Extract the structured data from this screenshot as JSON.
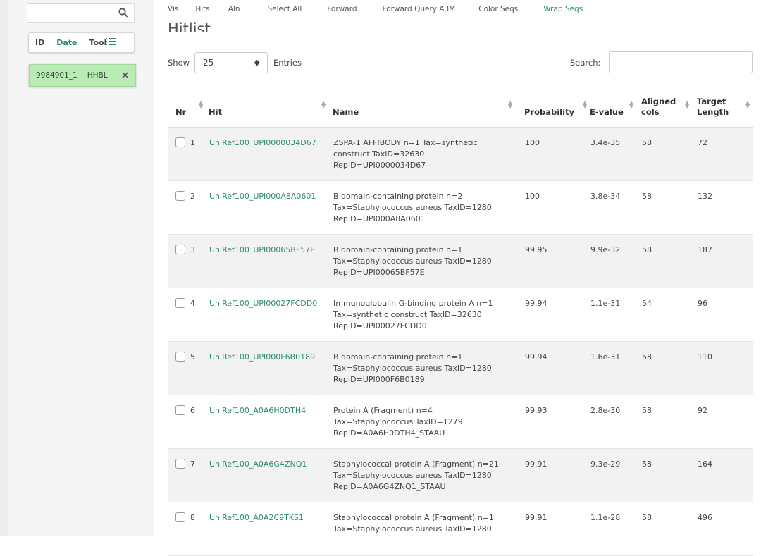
{
  "sidebar": {
    "search_icon": "search-icon",
    "sort": {
      "id": "ID",
      "date": "Date",
      "tool": "Tool"
    },
    "job": {
      "id": "9984901_1",
      "tool": "HHBL"
    }
  },
  "toolbar": {
    "vis": "Vis",
    "hits": "Hits",
    "aln": "Aln",
    "select_all": "Select All",
    "forward": "Forward",
    "forward_query": "Forward Query A3M",
    "color_seqs": "Color Seqs",
    "wrap_seqs": "Wrap Seqs"
  },
  "page_title": "Hitlist",
  "controls": {
    "show": "Show",
    "entries_value": "25",
    "entries": "Entries",
    "search": "Search:"
  },
  "table": {
    "headers": {
      "nr": "Nr",
      "hit": "Hit",
      "name": "Name",
      "probability": "Probability",
      "evalue": "E-value",
      "aligned_1": "Aligned",
      "aligned_2": "cols",
      "target_1": "Target",
      "target_2": "Length"
    },
    "rows": [
      {
        "nr": "1",
        "hit": "UniRef100_UPI0000034D67",
        "name": [
          "ZSPA-1 AFFIBODY n=1 Tax=synthetic",
          "construct TaxID=32630",
          "RepID=UPI0000034D67"
        ],
        "prob": "100",
        "evalue": "3.4e-35",
        "aligned": "58",
        "length": "72"
      },
      {
        "nr": "2",
        "hit": "UniRef100_UPI000A8A0601",
        "name": [
          "B domain-containing protein n=2",
          "Tax=Staphylococcus aureus TaxID=1280",
          "RepID=UPI000A8A0601"
        ],
        "prob": "100",
        "evalue": "3.8e-34",
        "aligned": "58",
        "length": "132"
      },
      {
        "nr": "3",
        "hit": "UniRef100_UPI00065BF57E",
        "name": [
          "B domain-containing protein n=1",
          "Tax=Staphylococcus aureus TaxID=1280",
          "RepID=UPI00065BF57E"
        ],
        "prob": "99.95",
        "evalue": "9.9e-32",
        "aligned": "58",
        "length": "187"
      },
      {
        "nr": "4",
        "hit": "UniRef100_UPI00027FCDD0",
        "name": [
          "Immunoglobulin G-binding protein A n=1",
          "Tax=synthetic construct TaxID=32630",
          "RepID=UPI00027FCDD0"
        ],
        "prob": "99.94",
        "evalue": "1.1e-31",
        "aligned": "54",
        "length": "96"
      },
      {
        "nr": "5",
        "hit": "UniRef100_UPI000F6B0189",
        "name": [
          "B domain-containing protein n=1",
          "Tax=Staphylococcus aureus TaxID=1280",
          "RepID=UPI000F6B0189"
        ],
        "prob": "99.94",
        "evalue": "1.6e-31",
        "aligned": "58",
        "length": "110"
      },
      {
        "nr": "6",
        "hit": "UniRef100_A0A6H0DTH4",
        "name": [
          "Protein A (Fragment) n=4",
          "Tax=Staphylococcus TaxID=1279",
          "RepID=A0A6H0DTH4_STAAU"
        ],
        "prob": "99.93",
        "evalue": "2.8e-30",
        "aligned": "58",
        "length": "92"
      },
      {
        "nr": "7",
        "hit": "UniRef100_A0A6G4ZNQ1",
        "name": [
          "Staphylococcal protein A (Fragment) n=21",
          "Tax=Staphylococcus aureus TaxID=1280",
          "RepID=A0A6G4ZNQ1_STAAU"
        ],
        "prob": "99.91",
        "evalue": "9.3e-29",
        "aligned": "58",
        "length": "164"
      },
      {
        "nr": "8",
        "hit": "UniRef100_A0A2C9TKS1",
        "name": [
          "Staphylococcal protein A (Fragment) n=1",
          "Tax=Staphylococcus aureus TaxID=1280",
          ""
        ],
        "prob": "99.91",
        "evalue": "1.1e-28",
        "aligned": "58",
        "length": "496"
      }
    ]
  }
}
